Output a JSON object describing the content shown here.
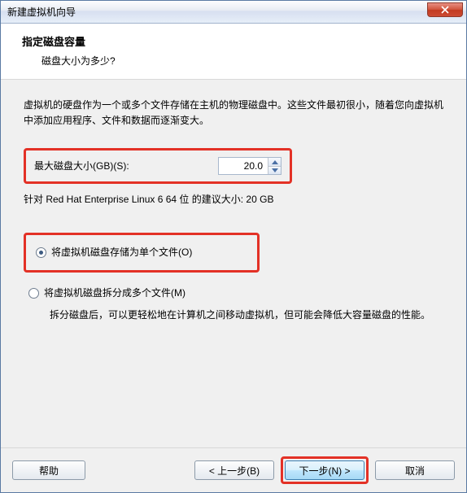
{
  "window": {
    "title": "新建虚拟机向导"
  },
  "header": {
    "title": "指定磁盘容量",
    "subtitle": "磁盘大小为多少?"
  },
  "content": {
    "description": "虚拟机的硬盘作为一个或多个文件存储在主机的物理磁盘中。这些文件最初很小，随着您向虚拟机中添加应用程序、文件和数据而逐渐变大。",
    "size_label": "最大磁盘大小(GB)(S):",
    "size_value": "20.0",
    "suggestion": "针对 Red Hat Enterprise Linux 6 64 位 的建议大小: 20 GB",
    "radio_single": "将虚拟机磁盘存储为单个文件(O)",
    "radio_split": "将虚拟机磁盘拆分成多个文件(M)",
    "split_desc": "拆分磁盘后，可以更轻松地在计算机之间移动虚拟机，但可能会降低大容量磁盘的性能。"
  },
  "footer": {
    "help": "帮助",
    "back": "< 上一步(B)",
    "next": "下一步(N) >",
    "cancel": "取消"
  }
}
